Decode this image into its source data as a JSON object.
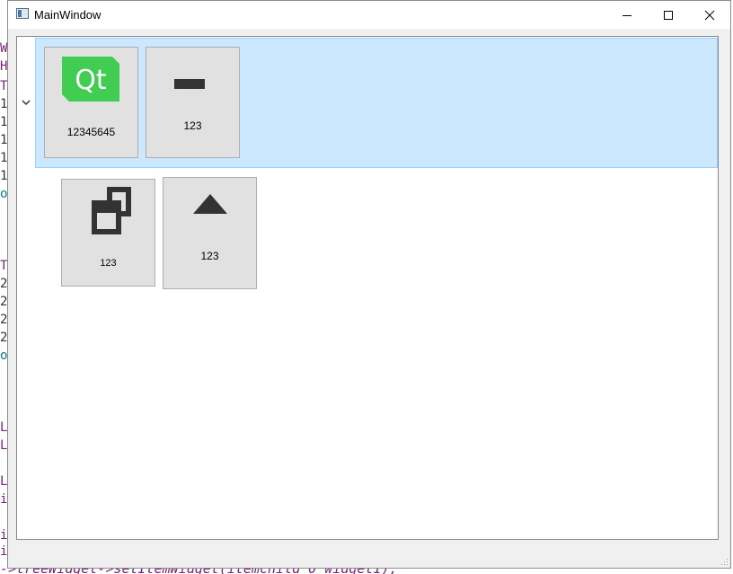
{
  "window": {
    "title": "MainWindow",
    "controls": {
      "minimize": "minimize",
      "maximize": "maximize",
      "close": "close"
    }
  },
  "tree": {
    "top_item": {
      "expanded": true,
      "selected": true,
      "tiles": [
        {
          "icon": "qt-logo-icon",
          "label": "12345645",
          "logo_text": "Qt"
        },
        {
          "icon": "minus-icon",
          "label": "123"
        }
      ]
    },
    "child_item": {
      "tiles": [
        {
          "icon": "restore-windows-icon",
          "label": "123"
        },
        {
          "icon": "triangle-up-icon",
          "label": "123"
        }
      ]
    }
  },
  "background_editor": {
    "bottom_line": "->treeWidget->setItemWidget(itemchild_0_widget1);"
  },
  "colors": {
    "selection_fill": "#cce8ff",
    "selection_border": "#99d1ff",
    "tile_fill": "#e1e1e1",
    "qt_green": "#41cd52",
    "icon_dark": "#333333"
  }
}
